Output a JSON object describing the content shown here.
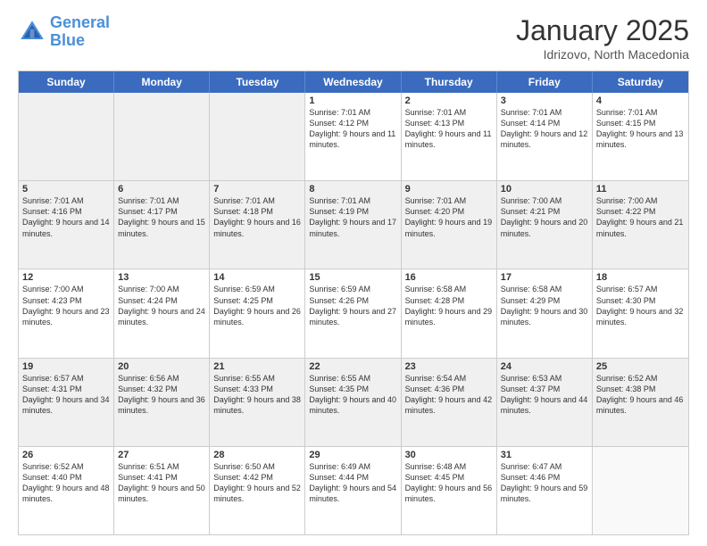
{
  "header": {
    "logo_line1": "General",
    "logo_line2": "Blue",
    "month": "January 2025",
    "location": "Idrizovo, North Macedonia"
  },
  "day_headers": [
    "Sunday",
    "Monday",
    "Tuesday",
    "Wednesday",
    "Thursday",
    "Friday",
    "Saturday"
  ],
  "rows": [
    [
      {
        "day": "",
        "info": "",
        "shaded": true,
        "empty": true
      },
      {
        "day": "",
        "info": "",
        "shaded": true,
        "empty": true
      },
      {
        "day": "",
        "info": "",
        "shaded": true,
        "empty": true
      },
      {
        "day": "1",
        "info": "Sunrise: 7:01 AM\nSunset: 4:12 PM\nDaylight: 9 hours\nand 11 minutes.",
        "shaded": false
      },
      {
        "day": "2",
        "info": "Sunrise: 7:01 AM\nSunset: 4:13 PM\nDaylight: 9 hours\nand 11 minutes.",
        "shaded": false
      },
      {
        "day": "3",
        "info": "Sunrise: 7:01 AM\nSunset: 4:14 PM\nDaylight: 9 hours\nand 12 minutes.",
        "shaded": false
      },
      {
        "day": "4",
        "info": "Sunrise: 7:01 AM\nSunset: 4:15 PM\nDaylight: 9 hours\nand 13 minutes.",
        "shaded": false
      }
    ],
    [
      {
        "day": "5",
        "info": "Sunrise: 7:01 AM\nSunset: 4:16 PM\nDaylight: 9 hours\nand 14 minutes.",
        "shaded": true
      },
      {
        "day": "6",
        "info": "Sunrise: 7:01 AM\nSunset: 4:17 PM\nDaylight: 9 hours\nand 15 minutes.",
        "shaded": true
      },
      {
        "day": "7",
        "info": "Sunrise: 7:01 AM\nSunset: 4:18 PM\nDaylight: 9 hours\nand 16 minutes.",
        "shaded": true
      },
      {
        "day": "8",
        "info": "Sunrise: 7:01 AM\nSunset: 4:19 PM\nDaylight: 9 hours\nand 17 minutes.",
        "shaded": true
      },
      {
        "day": "9",
        "info": "Sunrise: 7:01 AM\nSunset: 4:20 PM\nDaylight: 9 hours\nand 19 minutes.",
        "shaded": true
      },
      {
        "day": "10",
        "info": "Sunrise: 7:00 AM\nSunset: 4:21 PM\nDaylight: 9 hours\nand 20 minutes.",
        "shaded": true
      },
      {
        "day": "11",
        "info": "Sunrise: 7:00 AM\nSunset: 4:22 PM\nDaylight: 9 hours\nand 21 minutes.",
        "shaded": true
      }
    ],
    [
      {
        "day": "12",
        "info": "Sunrise: 7:00 AM\nSunset: 4:23 PM\nDaylight: 9 hours\nand 23 minutes.",
        "shaded": false
      },
      {
        "day": "13",
        "info": "Sunrise: 7:00 AM\nSunset: 4:24 PM\nDaylight: 9 hours\nand 24 minutes.",
        "shaded": false
      },
      {
        "day": "14",
        "info": "Sunrise: 6:59 AM\nSunset: 4:25 PM\nDaylight: 9 hours\nand 26 minutes.",
        "shaded": false
      },
      {
        "day": "15",
        "info": "Sunrise: 6:59 AM\nSunset: 4:26 PM\nDaylight: 9 hours\nand 27 minutes.",
        "shaded": false
      },
      {
        "day": "16",
        "info": "Sunrise: 6:58 AM\nSunset: 4:28 PM\nDaylight: 9 hours\nand 29 minutes.",
        "shaded": false
      },
      {
        "day": "17",
        "info": "Sunrise: 6:58 AM\nSunset: 4:29 PM\nDaylight: 9 hours\nand 30 minutes.",
        "shaded": false
      },
      {
        "day": "18",
        "info": "Sunrise: 6:57 AM\nSunset: 4:30 PM\nDaylight: 9 hours\nand 32 minutes.",
        "shaded": false
      }
    ],
    [
      {
        "day": "19",
        "info": "Sunrise: 6:57 AM\nSunset: 4:31 PM\nDaylight: 9 hours\nand 34 minutes.",
        "shaded": true
      },
      {
        "day": "20",
        "info": "Sunrise: 6:56 AM\nSunset: 4:32 PM\nDaylight: 9 hours\nand 36 minutes.",
        "shaded": true
      },
      {
        "day": "21",
        "info": "Sunrise: 6:55 AM\nSunset: 4:33 PM\nDaylight: 9 hours\nand 38 minutes.",
        "shaded": true
      },
      {
        "day": "22",
        "info": "Sunrise: 6:55 AM\nSunset: 4:35 PM\nDaylight: 9 hours\nand 40 minutes.",
        "shaded": true
      },
      {
        "day": "23",
        "info": "Sunrise: 6:54 AM\nSunset: 4:36 PM\nDaylight: 9 hours\nand 42 minutes.",
        "shaded": true
      },
      {
        "day": "24",
        "info": "Sunrise: 6:53 AM\nSunset: 4:37 PM\nDaylight: 9 hours\nand 44 minutes.",
        "shaded": true
      },
      {
        "day": "25",
        "info": "Sunrise: 6:52 AM\nSunset: 4:38 PM\nDaylight: 9 hours\nand 46 minutes.",
        "shaded": true
      }
    ],
    [
      {
        "day": "26",
        "info": "Sunrise: 6:52 AM\nSunset: 4:40 PM\nDaylight: 9 hours\nand 48 minutes.",
        "shaded": false
      },
      {
        "day": "27",
        "info": "Sunrise: 6:51 AM\nSunset: 4:41 PM\nDaylight: 9 hours\nand 50 minutes.",
        "shaded": false
      },
      {
        "day": "28",
        "info": "Sunrise: 6:50 AM\nSunset: 4:42 PM\nDaylight: 9 hours\nand 52 minutes.",
        "shaded": false
      },
      {
        "day": "29",
        "info": "Sunrise: 6:49 AM\nSunset: 4:44 PM\nDaylight: 9 hours\nand 54 minutes.",
        "shaded": false
      },
      {
        "day": "30",
        "info": "Sunrise: 6:48 AM\nSunset: 4:45 PM\nDaylight: 9 hours\nand 56 minutes.",
        "shaded": false
      },
      {
        "day": "31",
        "info": "Sunrise: 6:47 AM\nSunset: 4:46 PM\nDaylight: 9 hours\nand 59 minutes.",
        "shaded": false
      },
      {
        "day": "",
        "info": "",
        "shaded": false,
        "empty": true
      }
    ]
  ]
}
